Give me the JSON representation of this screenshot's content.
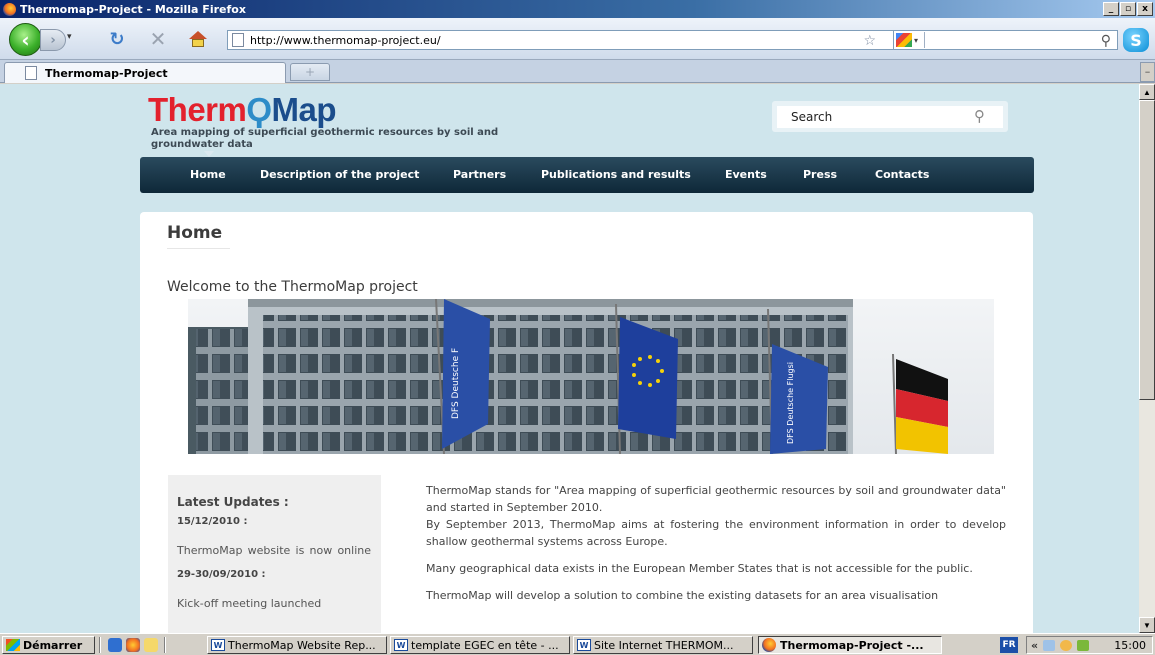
{
  "window": {
    "title": "Thermomap-Project - Mozilla Firefox",
    "controls": [
      "_",
      "▫",
      "x"
    ]
  },
  "toolbar": {
    "url": "http://www.thermomap-project.eu/"
  },
  "tab": {
    "label": "Thermomap-Project",
    "new_tab_symbol": "+"
  },
  "site": {
    "logo_therm": "Therm",
    "logo_arrows": "Ϙ",
    "logo_map": "Map",
    "tagline": "Area mapping of superficial geothermic resources by soil and groundwater data",
    "search_placeholder": "Search",
    "nav": [
      "Home",
      "Description of the project",
      "Partners",
      "Publications and results",
      "Events",
      "Press",
      "Contacts"
    ]
  },
  "content": {
    "page_title": "Home",
    "welcome": "Welcome to the ThermoMap project",
    "sidebar": {
      "title": "Latest Updates :",
      "date1": "15/12/2010 :",
      "text1": "ThermoMap website is now online",
      "date2": "29-30/09/2010 :",
      "text2": "Kick-off meeting launched"
    },
    "paragraphs": [
      "ThermoMap stands for \"Area mapping of superficial geothermic resources by soil and groundwater data\" and started in September 2010.",
      "By September 2013, ThermoMap aims at fostering the environment information in order to develop shallow geothermal systems across Europe.",
      "Many geographical data exists in the European Member States that is not accessible for the public.",
      "ThermoMap will develop a solution to combine the existing datasets for an area visualisation"
    ]
  },
  "taskbar": {
    "start": "Démarrer",
    "tasks": [
      "ThermoMap Website Rep...",
      "template EGEC en tête - ...",
      "Site Internet THERMOM...",
      "Thermomap-Project -..."
    ],
    "language": "FR",
    "tray_chevron": "«",
    "clock": "15:00"
  },
  "colors": {
    "logo_red": "#e3212d",
    "logo_blue": "#1b4d8c",
    "nav_bg": "#0e2838",
    "page_bg": "#cfe5ec"
  }
}
